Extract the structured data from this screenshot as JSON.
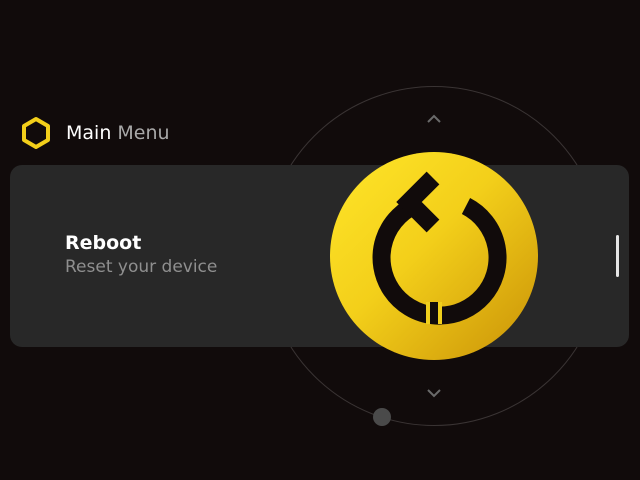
{
  "header": {
    "title_main": "Main",
    "title_sub": "Menu",
    "logo_icon": "hexagon-logo-icon"
  },
  "menu_item": {
    "title": "Reboot",
    "subtitle": "Reset your device",
    "icon": "reboot-icon"
  },
  "dial": {
    "up_icon": "chevron-up-icon",
    "down_icon": "chevron-down-icon"
  },
  "colors": {
    "background": "#110b0b",
    "card": "#282828",
    "accent": "#f3cf1a",
    "icon_dark": "#110b0b"
  }
}
